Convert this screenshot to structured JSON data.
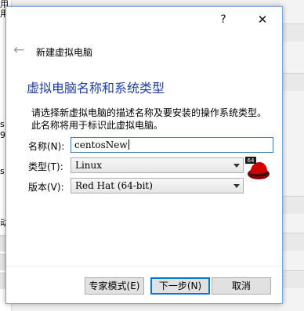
{
  "background": {
    "fragments": [
      "用",
      "用",
      "s",
      "9",
      "s",
      "动"
    ]
  },
  "dialog": {
    "help_glyph": "?",
    "close_glyph": "✕",
    "wizard_title": "新建虚拟电脑",
    "heading": "虚拟电脑名称和系统类型",
    "description": "请选择新虚拟电脑的描述名称及要安装的操作系统类型。此名称将用于标识此虚拟电脑。",
    "name_label": "名称(N):",
    "name_value": "centosNew",
    "type_label": "类型(T):",
    "type_value": "Linux",
    "version_label": "版本(V):",
    "version_value": "Red Hat (64-bit)",
    "os_icon": "redhat-64-icon",
    "os_icon_badge": "64",
    "buttons": {
      "expert": "专家模式(E)",
      "next": "下一步(N)",
      "cancel": "取消"
    }
  },
  "colors": {
    "heading": "#1f3fa6",
    "focus_border": "#3c7fc2",
    "primary_button_border": "#0078d7"
  }
}
